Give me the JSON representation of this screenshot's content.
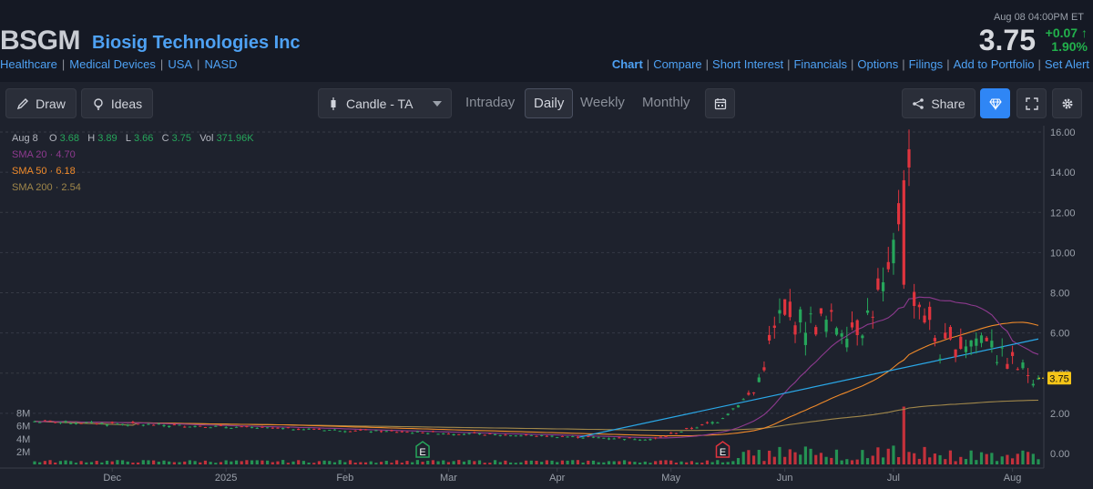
{
  "header": {
    "ticker": "BSGM",
    "company": "Biosig Technologies Inc",
    "crumbs": [
      "Healthcare",
      "Medical Devices",
      "USA",
      "NASD"
    ],
    "datetime": "Aug 08  04:00PM ET",
    "price": "3.75",
    "change": "+0.07",
    "change_pct": "1.90%",
    "links": [
      "Chart",
      "Compare",
      "Short Interest",
      "Financials",
      "Options",
      "Filings",
      "Add to Portfolio",
      "Set Alert"
    ]
  },
  "toolbar": {
    "draw": "Draw",
    "ideas": "Ideas",
    "chart_type": "Candle - TA",
    "timeframes": [
      "Intraday",
      "Daily",
      "Weekly",
      "Monthly"
    ],
    "active_timeframe": "Daily",
    "share": "Share"
  },
  "legend": {
    "date": "Aug 8",
    "o_label": "O",
    "o": "3.68",
    "h_label": "H",
    "h": "3.89",
    "l_label": "L",
    "l": "3.66",
    "c_label": "C",
    "c": "3.75",
    "vol_label": "Vol",
    "vol": "371.96K",
    "sma20_label": "SMA 20",
    "sma20": "4.70",
    "sma50_label": "SMA 50",
    "sma50": "6.18",
    "sma200_label": "SMA 200",
    "sma200": "2.54"
  },
  "colors": {
    "up": "#26a65b",
    "down": "#e0343e",
    "sma20": "#8e3a8f",
    "sma50": "#f08a2a",
    "sma200": "#a0874a",
    "trendline": "#2aa8e8",
    "price_tag": "#f5c518"
  },
  "chart_data": {
    "type": "candlestick",
    "title": "BSGM",
    "ylim": [
      0,
      16
    ],
    "yticks": [
      "0.00",
      "2.00",
      "4.00",
      "6.00",
      "8.00",
      "10.00",
      "12.00",
      "14.00",
      "16.00"
    ],
    "vol_ticks": [
      "2M",
      "4M",
      "6M",
      "8M"
    ],
    "x_ticks": [
      "Dec",
      "2025",
      "Feb",
      "Mar",
      "Apr",
      "May",
      "Jun",
      "Jul",
      "Aug"
    ],
    "last_price": "3.75",
    "earnings_markers": [
      {
        "label": "E",
        "date": "Feb 24",
        "kind": "positive"
      },
      {
        "label": "E",
        "date": "May 15",
        "kind": "negative"
      }
    ],
    "segments": [
      {
        "from": "Nov 11",
        "to": "Apr 25",
        "start": 1.6,
        "end": 0.72
      },
      {
        "from": "Apr 28",
        "to": "May 13",
        "start": 0.73,
        "end": 1.55
      },
      {
        "from": "May 14",
        "to": "May 22",
        "start": 1.6,
        "end": 2.9
      },
      {
        "from": "May 23",
        "to": "May 30",
        "start": 3.0,
        "end": 6.8
      },
      {
        "from": "Jun 2",
        "to": "Jun 20",
        "start": 6.6,
        "end": 6.4
      },
      {
        "from": "Jun 23",
        "to": "Jun 27",
        "start": 6.5,
        "end": 8.1
      },
      {
        "from": "Jun 30",
        "to": "Jul 3",
        "start": 8.3,
        "end": 13.6
      },
      {
        "from": "Jul 7",
        "to": "Jul 14",
        "start": 8.0,
        "end": 5.1
      },
      {
        "from": "Jul 15",
        "to": "Jul 28",
        "start": 5.2,
        "end": 6.0
      },
      {
        "from": "Jul 29",
        "to": "Aug 8",
        "start": 4.9,
        "end": 3.75
      }
    ],
    "trendline": {
      "from": {
        "date": "Apr 7",
        "value": 0.8
      },
      "to": {
        "date": "Aug 8",
        "value": 5.7
      }
    },
    "sma20_last": 4.7,
    "sma50_last": 6.18,
    "sma200_last": 2.54
  }
}
